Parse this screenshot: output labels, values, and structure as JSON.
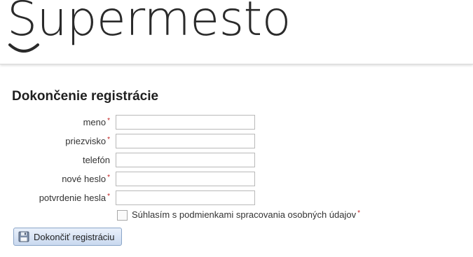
{
  "header": {
    "logo_text": "Supermesto"
  },
  "form": {
    "title": "Dokončenie registrácie",
    "required_marker": "*",
    "fields": [
      {
        "label": "meno",
        "required": true,
        "value": ""
      },
      {
        "label": "priezvisko",
        "required": true,
        "value": ""
      },
      {
        "label": "telefón",
        "required": false,
        "value": ""
      },
      {
        "label": "nové heslo",
        "required": true,
        "value": ""
      },
      {
        "label": "potvrdenie hesla",
        "required": true,
        "value": ""
      }
    ],
    "consent": {
      "label": "Súhlasím s podmienkami spracovania osobných údajov",
      "required": true,
      "checked": false
    },
    "submit_label": "Dokončiť registráciu",
    "submit_icon": "floppy-disk-icon"
  },
  "colors": {
    "required": "#c02020",
    "button_border": "#8aa5c8"
  }
}
